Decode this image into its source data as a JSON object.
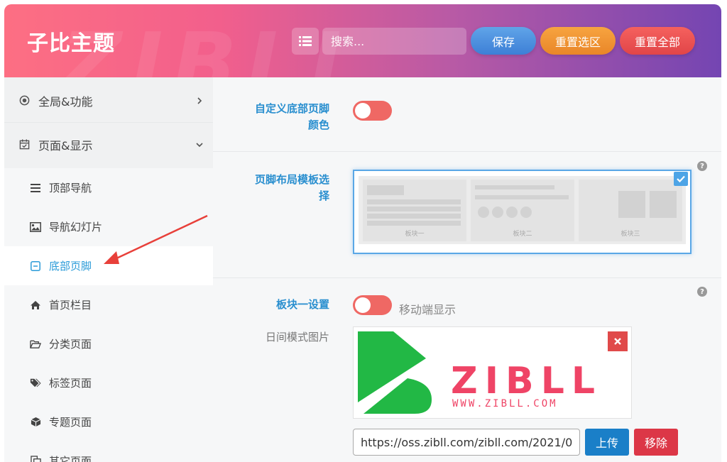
{
  "header": {
    "brand": "子比主题",
    "watermark": "ZIBLL",
    "search_placeholder": "搜索...",
    "save_label": "保存",
    "reset_section_label": "重置选区",
    "reset_all_label": "重置全部"
  },
  "sidebar": {
    "groups": [
      {
        "label": "全局&功能",
        "icon": "target-icon",
        "expanded": false
      },
      {
        "label": "页面&显示",
        "icon": "calendar-check-icon",
        "expanded": true
      }
    ],
    "items": [
      {
        "label": "顶部导航",
        "icon": "bars-icon"
      },
      {
        "label": "导航幻灯片",
        "icon": "image-icon"
      },
      {
        "label": "底部页脚",
        "icon": "minus-square-icon",
        "active": true
      },
      {
        "label": "首页栏目",
        "icon": "home-icon"
      },
      {
        "label": "分类页面",
        "icon": "folder-open-icon"
      },
      {
        "label": "标签页面",
        "icon": "tags-icon"
      },
      {
        "label": "专题页面",
        "icon": "cube-icon"
      },
      {
        "label": "其它页面",
        "icon": "copy-icon"
      }
    ]
  },
  "main": {
    "custom_color": {
      "label_line1": "自定义底部页脚",
      "label_line2": "颜色",
      "enabled": false
    },
    "layout_template": {
      "label_line1": "页脚布局模板选",
      "label_line2": "择",
      "cards": [
        "板块一",
        "板块二",
        "板块三"
      ],
      "selected": true
    },
    "block_one": {
      "label": "板块一设置",
      "mobile_toggle_label": "移动端显示",
      "mobile_enabled": false,
      "day_image_label": "日间模式图片",
      "logo_text": "ZIBLL",
      "logo_url_text": "WWW.ZIBLL.COM",
      "image_url": "https://oss.zibll.com/zibll.com/2021/0",
      "upload_label": "上传",
      "remove_label": "移除"
    }
  },
  "colors": {
    "accent": "#2a8fcf",
    "toggle_off": "#ef6864",
    "save": "#3d7fd6",
    "reset_section": "#e98628",
    "reset_all": "#e14548",
    "upload": "#1a7fc8",
    "remove": "#dc3747",
    "logo_green": "#22b845",
    "logo_pink": "#ef4466"
  }
}
